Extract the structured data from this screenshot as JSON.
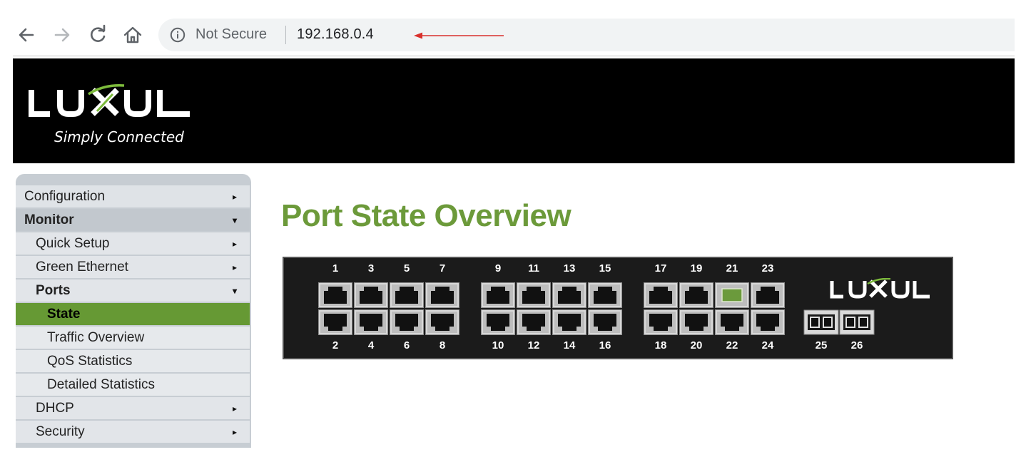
{
  "browser": {
    "security_label": "Not Secure",
    "url": "192.168.0.4",
    "annotation_color": "#d9302c"
  },
  "header": {
    "logo_text": "LUXUL",
    "tagline": "Simply Connected"
  },
  "sidebar": {
    "items": [
      {
        "label": "Configuration",
        "indicator": "▸"
      },
      {
        "label": "Monitor",
        "indicator": "▾"
      },
      {
        "label": "Quick Setup",
        "indicator": "▸"
      },
      {
        "label": "Green Ethernet",
        "indicator": "▸"
      },
      {
        "label": "Ports",
        "indicator": "▾"
      },
      {
        "label": "State",
        "indicator": ""
      },
      {
        "label": "Traffic Overview",
        "indicator": ""
      },
      {
        "label": "QoS Statistics",
        "indicator": ""
      },
      {
        "label": "Detailed Statistics",
        "indicator": ""
      },
      {
        "label": "DHCP",
        "indicator": "▸"
      },
      {
        "label": "Security",
        "indicator": "▸"
      }
    ]
  },
  "main": {
    "title": "Port State Overview",
    "panel_logo_text": "LUXUL",
    "ports_top": [
      "1",
      "3",
      "5",
      "7",
      "9",
      "11",
      "13",
      "15",
      "17",
      "19",
      "21",
      "23"
    ],
    "ports_bottom": [
      "2",
      "4",
      "6",
      "8",
      "10",
      "12",
      "14",
      "16",
      "18",
      "20",
      "22",
      "24"
    ],
    "sfp_ports": [
      "25",
      "26"
    ],
    "active_ports": [
      "21"
    ],
    "colors": {
      "link_up": "#6b9a3c",
      "accent": "#6c9a3a",
      "menu_active": "#669934"
    }
  }
}
